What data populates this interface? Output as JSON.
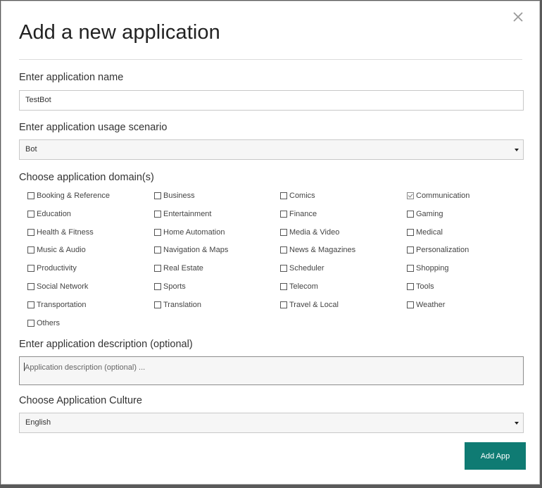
{
  "dialog": {
    "title": "Add a new application",
    "close_icon": "close-icon"
  },
  "name": {
    "label": "Enter application name",
    "value": "TestBot"
  },
  "scenario": {
    "label": "Enter application usage scenario",
    "value": "Bot"
  },
  "domains": {
    "label": "Choose application domain(s)",
    "items": [
      {
        "label": "Booking & Reference",
        "checked": false
      },
      {
        "label": "Business",
        "checked": false
      },
      {
        "label": "Comics",
        "checked": false
      },
      {
        "label": "Communication",
        "checked": true
      },
      {
        "label": "Education",
        "checked": false
      },
      {
        "label": "Entertainment",
        "checked": false
      },
      {
        "label": "Finance",
        "checked": false
      },
      {
        "label": "Gaming",
        "checked": false
      },
      {
        "label": "Health & Fitness",
        "checked": false
      },
      {
        "label": "Home Automation",
        "checked": false
      },
      {
        "label": "Media & Video",
        "checked": false
      },
      {
        "label": "Medical",
        "checked": false
      },
      {
        "label": "Music & Audio",
        "checked": false
      },
      {
        "label": "Navigation & Maps",
        "checked": false
      },
      {
        "label": "News & Magazines",
        "checked": false
      },
      {
        "label": "Personalization",
        "checked": false
      },
      {
        "label": "Productivity",
        "checked": false
      },
      {
        "label": "Real Estate",
        "checked": false
      },
      {
        "label": "Scheduler",
        "checked": false
      },
      {
        "label": "Shopping",
        "checked": false
      },
      {
        "label": "Social Network",
        "checked": false
      },
      {
        "label": "Sports",
        "checked": false
      },
      {
        "label": "Telecom",
        "checked": false
      },
      {
        "label": "Tools",
        "checked": false
      },
      {
        "label": "Transportation",
        "checked": false
      },
      {
        "label": "Translation",
        "checked": false
      },
      {
        "label": "Travel & Local",
        "checked": false
      },
      {
        "label": "Weather",
        "checked": false
      },
      {
        "label": "Others",
        "checked": false
      }
    ]
  },
  "description": {
    "label": "Enter application description (optional)",
    "placeholder": "Application description (optional) ..."
  },
  "culture": {
    "label": "Choose Application Culture",
    "value": "English"
  },
  "actions": {
    "add_label": "Add App"
  },
  "colors": {
    "accent": "#0f7b73"
  }
}
